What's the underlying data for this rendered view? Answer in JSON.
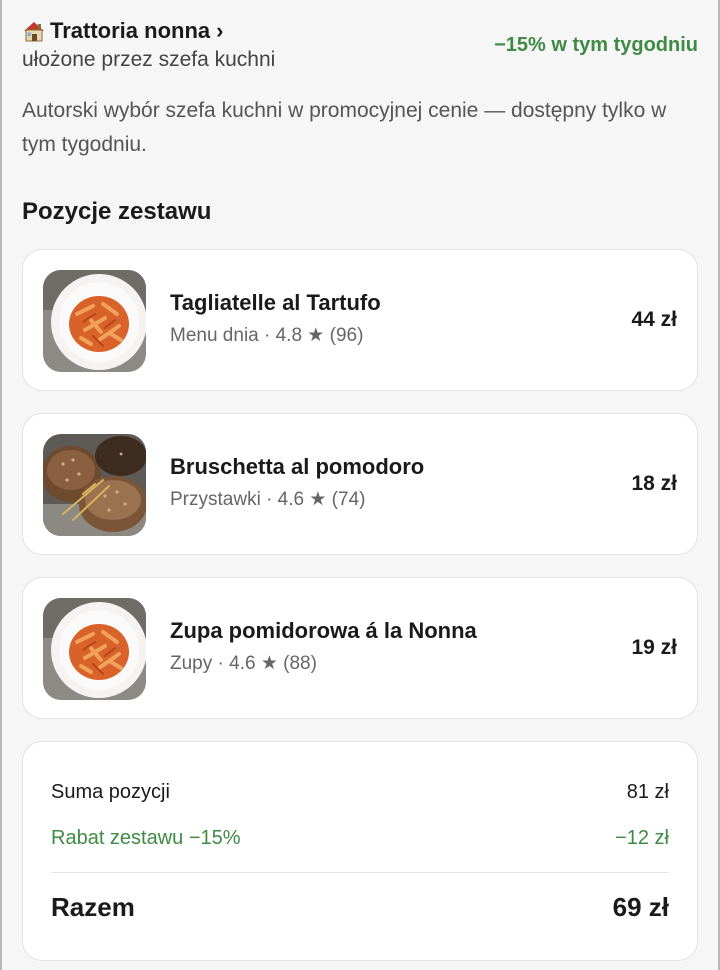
{
  "header": {
    "restaurant_name": "Trattoria nonna",
    "chevron": "›",
    "subtitle": "ułożone przez szefa kuchni",
    "discount_label": "−15% w tym tygodniu",
    "icon": "house-icon"
  },
  "description": "Autorski wybór szefa kuchni w promocyjnej cenie — dostępny tylko w tym tygodniu.",
  "section_title": "Pozycje zestawu",
  "items": [
    {
      "name": "Tagliatelle al Tartufo",
      "meta": "Menu dnia · 4.8 ★ (96)",
      "price": "44 zł",
      "image": "pasta-image"
    },
    {
      "name": "Bruschetta al pomodoro",
      "meta": "Przystawki · 4.6 ★ (74)",
      "price": "18 zł",
      "image": "bread-image"
    },
    {
      "name": "Zupa pomidorowa á la Nonna",
      "meta": "Zupy · 4.6 ★ (88)",
      "price": "19 zł",
      "image": "pasta-image"
    }
  ],
  "summary": {
    "subtotal_label": "Suma pozycji",
    "subtotal_value": "81 zł",
    "discount_label": "Rabat zestawu −15%",
    "discount_value": "−12 zł",
    "total_label": "Razem",
    "total_value": "69 zł"
  },
  "colors": {
    "accent_green": "#3f8a44",
    "background": "#f6f6f6",
    "card": "#ffffff"
  }
}
